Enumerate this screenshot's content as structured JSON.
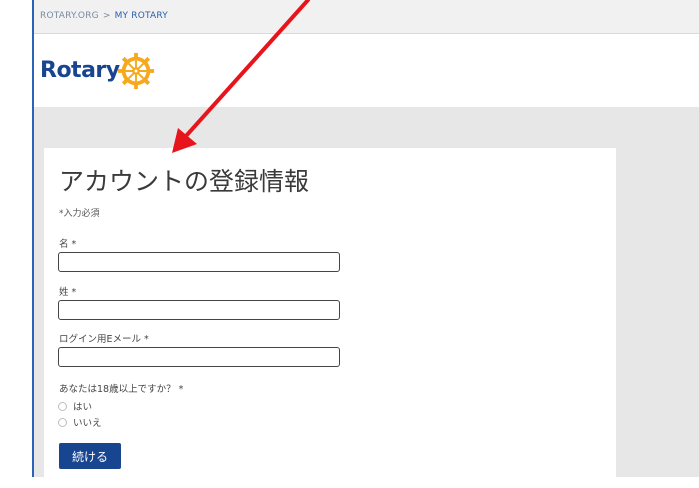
{
  "breadcrumb": {
    "root": "ROTARY.ORG",
    "separator": ">",
    "current": "MY ROTARY"
  },
  "logo": {
    "text": "Rotary",
    "brand_color": "#17458f",
    "wheel_color": "#f7a81b"
  },
  "form": {
    "title": "アカウントの登録情報",
    "required_note": "*入力必須",
    "fields": [
      {
        "label": "名 *",
        "value": ""
      },
      {
        "label": "姓 *",
        "value": ""
      },
      {
        "label": "ログイン用Eメール *",
        "value": ""
      }
    ],
    "age_question": "あなたは18歳以上ですか？ *",
    "radio_options": [
      "はい",
      "いいえ"
    ],
    "submit_label": "続ける"
  },
  "annotation": {
    "icon": "red-arrow-icon",
    "color": "#e8141c"
  }
}
